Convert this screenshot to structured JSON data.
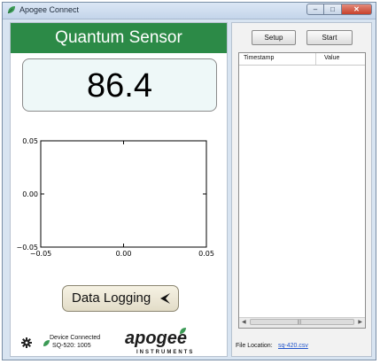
{
  "window": {
    "title": "Apogee Connect",
    "controls": {
      "minimize": "–",
      "maximize": "□",
      "close": "✕"
    }
  },
  "sensor": {
    "title": "Quantum Sensor",
    "reading": "86.4"
  },
  "plot": {
    "y_ticks": [
      "0.05",
      "0.00",
      "−0.05"
    ],
    "x_ticks": [
      "−0.05",
      "0.00",
      "0.05"
    ]
  },
  "chart_data": {
    "type": "line",
    "series": [],
    "xlim": [
      -0.05,
      0.05
    ],
    "ylim": [
      -0.05,
      0.05
    ],
    "x_ticks": [
      -0.05,
      0.0,
      0.05
    ],
    "y_ticks": [
      -0.05,
      0.0,
      0.05
    ]
  },
  "logging": {
    "button_label": "Data Logging"
  },
  "status": {
    "connection": "Device Connected",
    "device": "SQ-520: 1005"
  },
  "brand": {
    "logo": "apogee",
    "tagline": "INSTRUMENTS"
  },
  "toolbar": {
    "setup": "Setup",
    "start": "Start"
  },
  "table": {
    "columns": [
      "Timestamp",
      "Value"
    ],
    "rows": []
  },
  "file": {
    "label": "File Location:",
    "name": "sq-420.csv"
  },
  "colors": {
    "header_green": "#2c8a47",
    "reading_bg": "#eef8f8",
    "link": "#2255cc"
  }
}
